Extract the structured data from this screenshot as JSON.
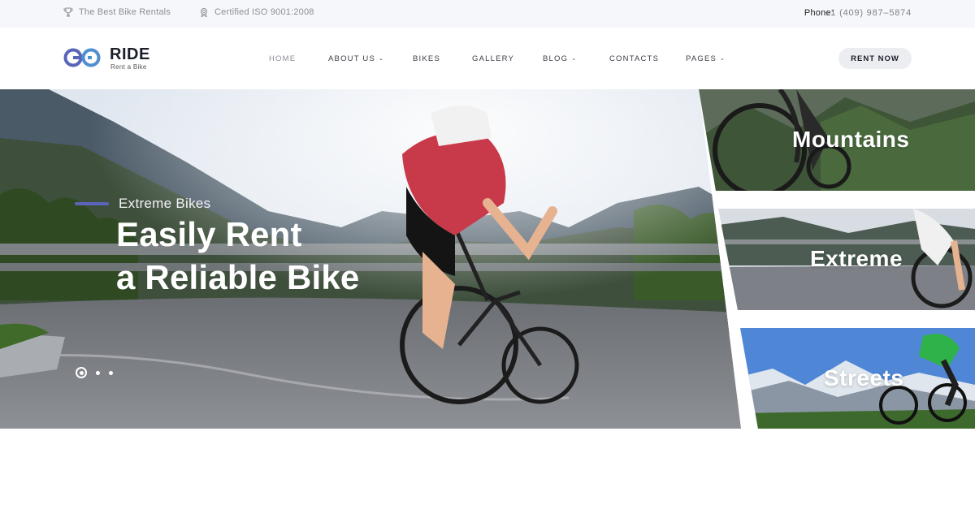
{
  "topbar": {
    "rentals": "The Best Bike Rentals",
    "iso": "Certified ISO 9001:2008",
    "phone_label": "Phone:",
    "phone_number": "+1 (409) 987–5874",
    "icons": [
      "trophy-icon",
      "badge-icon"
    ]
  },
  "brand": {
    "name": "RIDE",
    "tagline": "Rent a Bike",
    "accent": "#5a64b8"
  },
  "nav": [
    {
      "label": "HOME",
      "active": true
    },
    {
      "label": "ABOUT US",
      "dropdown": true
    },
    {
      "label": "BIKES"
    },
    {
      "label": "GALLERY"
    },
    {
      "label": "BLOG",
      "dropdown": true
    },
    {
      "label": "CONTACTS"
    },
    {
      "label": "PAGES",
      "dropdown": true
    }
  ],
  "cta": {
    "label": "RENT NOW"
  },
  "hero": {
    "eyebrow": "Extreme Bikes",
    "title_line1": "Easily Rent",
    "title_line2": "a Reliable Bike",
    "slides": 3,
    "active_slide": 1
  },
  "categories": [
    {
      "label": "Mountains"
    },
    {
      "label": "Extreme"
    },
    {
      "label": "Streets"
    }
  ]
}
